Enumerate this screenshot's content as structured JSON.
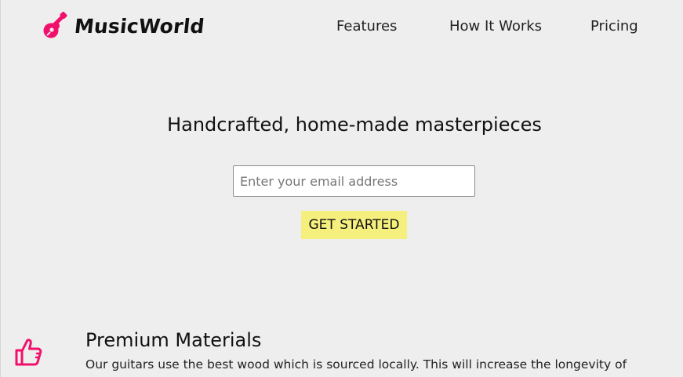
{
  "brand": {
    "name": "MusicWorld",
    "logo_icon": "guitar-icon",
    "accent_color": "#f1106b"
  },
  "nav": {
    "links": [
      {
        "label": "Features"
      },
      {
        "label": "How It Works"
      },
      {
        "label": "Pricing"
      }
    ]
  },
  "hero": {
    "title": "Handcrafted, home-made masterpieces",
    "email_placeholder": "Enter your email address",
    "email_value": "",
    "cta_label": "GET STARTED",
    "cta_color": "#f5f07d"
  },
  "features": [
    {
      "icon": "thumbs-up-icon",
      "title": "Premium Materials",
      "description": "Our guitars use the best wood which is sourced locally. This will increase the longevity of"
    }
  ]
}
